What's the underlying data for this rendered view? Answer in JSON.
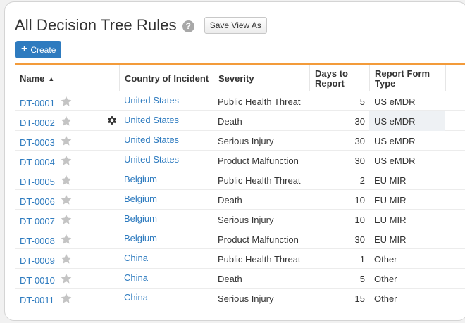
{
  "page": {
    "title": "All Decision Tree Rules",
    "help_icon_glyph": "?",
    "save_view_label": "Save View As",
    "create_label": "Create",
    "create_icon_glyph": "+"
  },
  "table": {
    "columns": {
      "name": "Name",
      "country": "Country of Incident",
      "severity": "Severity",
      "days": "Days to Report",
      "report_form": "Report Form Type"
    },
    "sort_indicator": "▲",
    "rows": [
      {
        "name": "DT-0001",
        "country": "United States",
        "severity": "Public Health Threat",
        "days": "5",
        "form": "US eMDR"
      },
      {
        "name": "DT-0002",
        "country": "United States",
        "severity": "Death",
        "days": "30",
        "form": "US eMDR"
      },
      {
        "name": "DT-0003",
        "country": "United States",
        "severity": "Serious Injury",
        "days": "30",
        "form": "US eMDR"
      },
      {
        "name": "DT-0004",
        "country": "United States",
        "severity": "Product Malfunction",
        "days": "30",
        "form": "US eMDR"
      },
      {
        "name": "DT-0005",
        "country": "Belgium",
        "severity": "Public Health Threat",
        "days": "2",
        "form": "EU MIR"
      },
      {
        "name": "DT-0006",
        "country": "Belgium",
        "severity": "Death",
        "days": "10",
        "form": "EU MIR"
      },
      {
        "name": "DT-0007",
        "country": "Belgium",
        "severity": "Serious Injury",
        "days": "10",
        "form": "EU MIR"
      },
      {
        "name": "DT-0008",
        "country": "Belgium",
        "severity": "Product Malfunction",
        "days": "30",
        "form": "EU MIR"
      },
      {
        "name": "DT-0009",
        "country": "China",
        "severity": "Public Health Threat",
        "days": "1",
        "form": "Other"
      },
      {
        "name": "DT-0010",
        "country": "China",
        "severity": "Death",
        "days": "5",
        "form": "Other"
      },
      {
        "name": "DT-0011",
        "country": "China",
        "severity": "Serious Injury",
        "days": "15",
        "form": "Other"
      }
    ]
  },
  "colors": {
    "accent": "#2e7bbf",
    "header_rule": "#f39b3a",
    "star": "#c4c4c4"
  },
  "icons": {
    "star": "star-icon",
    "gear": "gear-icon",
    "help": "help-icon",
    "sort": "sort-ascending-icon"
  }
}
